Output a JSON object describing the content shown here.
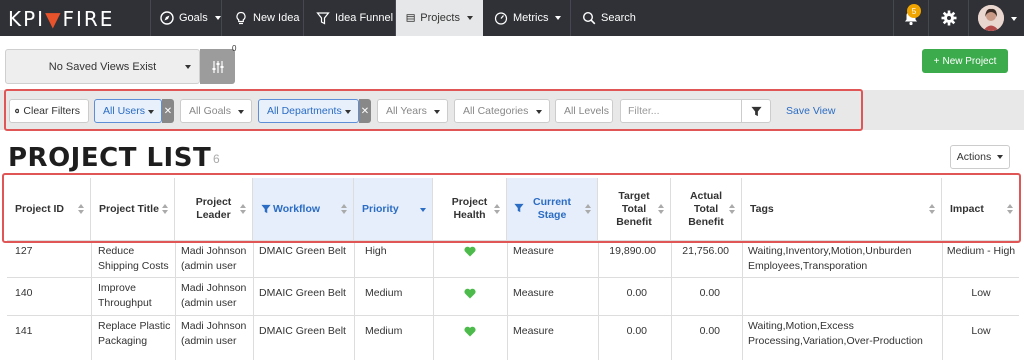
{
  "brand": {
    "logo_left": "KPI",
    "logo_right": "FIRE"
  },
  "nav": {
    "items": [
      {
        "label": "Goals",
        "icon": "compass-icon",
        "has_caret": true
      },
      {
        "label": "New Idea",
        "icon": "lightbulb-icon",
        "has_caret": false
      },
      {
        "label": "Idea Funnel",
        "icon": "funnel-icon",
        "has_caret": false
      },
      {
        "label": "Projects",
        "icon": "projects-icon",
        "has_caret": true,
        "active": true
      },
      {
        "label": "Metrics",
        "icon": "gauge-icon",
        "has_caret": true
      },
      {
        "label": "Search",
        "icon": "search-icon",
        "has_caret": false
      }
    ],
    "notification_count": "5"
  },
  "saved_views": {
    "label": "No Saved Views Exist",
    "count": "0"
  },
  "new_project_label": "New Project",
  "filters": {
    "clear_label": "Clear Filters",
    "users": "All Users",
    "goals": "All Goals",
    "departments": "All Departments",
    "years": "All Years",
    "categories": "All Categories",
    "levels": "All Levels",
    "filter_placeholder": "Filter...",
    "save_view_label": "Save View"
  },
  "page": {
    "title": "PROJECT LIST",
    "count": "6",
    "actions_label": "Actions"
  },
  "table": {
    "headers": {
      "project_id": "Project ID",
      "project_title": "Project Title",
      "project_leader": "Project Leader",
      "workflow": "Workflow",
      "priority": "Priority",
      "project_health": "Project Health",
      "current_stage": "Current Stage",
      "target_total_benefit": "Target Total Benefit",
      "actual_total_benefit": "Actual Total Benefit",
      "tags": "Tags",
      "impact": "Impact"
    },
    "rows": [
      {
        "id": "127",
        "title": "Reduce Shipping Costs",
        "leader": "Madi Johnson (admin user",
        "workflow": "DMAIC Green Belt",
        "priority": "High",
        "stage": "Measure",
        "target": "19,890.00",
        "actual": "21,756.00",
        "tags": "Waiting,Inventory,Motion,Unburden Employees,Transporation",
        "impact": "Medium - High"
      },
      {
        "id": "140",
        "title": "Improve Throughput",
        "leader": "Madi Johnson (admin user",
        "workflow": "DMAIC Green Belt",
        "priority": "Medium",
        "stage": "Measure",
        "target": "0.00",
        "actual": "0.00",
        "tags": "",
        "impact": "Low"
      },
      {
        "id": "141",
        "title": "Replace Plastic Packaging",
        "leader": "Madi Johnson (admin user",
        "workflow": "DMAIC Green Belt",
        "priority": "Medium",
        "stage": "Measure",
        "target": "0.00",
        "actual": "0.00",
        "tags": "Waiting,Motion,Excess Processing,Variation,Over-Production",
        "impact": "Low"
      }
    ]
  },
  "colors": {
    "nav_bg": "#2f3136",
    "accent_blue": "#2b6cc4",
    "green": "#3cab4c",
    "highlight_red": "#e05555",
    "health_green": "#4cbb4c"
  }
}
